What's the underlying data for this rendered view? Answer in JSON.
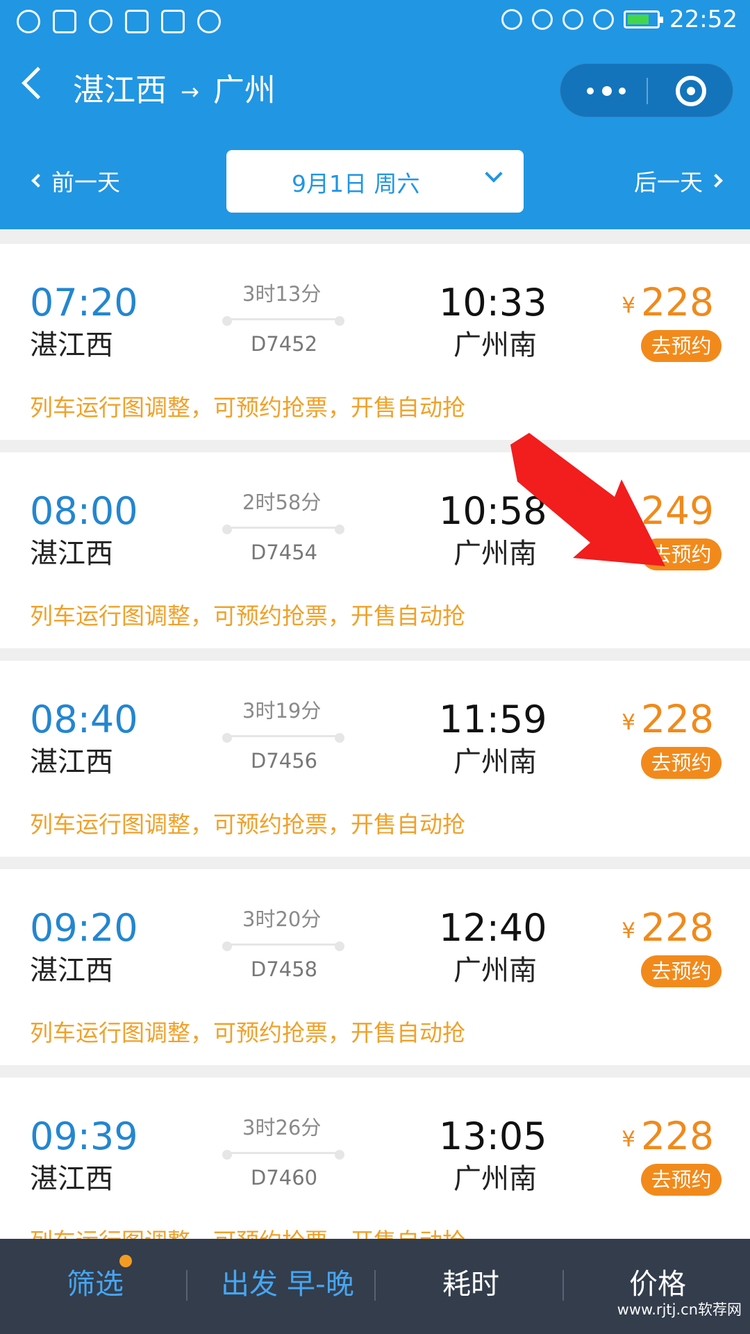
{
  "status_bar": {
    "time": "22:52"
  },
  "header": {
    "origin": "湛江西",
    "arrow": "→",
    "destination": "广州",
    "prev_day": "前一天",
    "date": "9月1日 周六",
    "next_day": "后一天"
  },
  "trains": [
    {
      "dep_time": "07:20",
      "dep_station": "湛江西",
      "duration": "3时13分",
      "train_no": "D7452",
      "arr_time": "10:33",
      "arr_station": "广州南",
      "price_symbol": "¥",
      "price": "228",
      "button": "去预约",
      "notice": "列车运行图调整，可预约抢票，开售自动抢"
    },
    {
      "dep_time": "08:00",
      "dep_station": "湛江西",
      "duration": "2时58分",
      "train_no": "D7454",
      "arr_time": "10:58",
      "arr_station": "广州南",
      "price_symbol": "¥",
      "price": "249",
      "button": "去预约",
      "notice": "列车运行图调整，可预约抢票，开售自动抢"
    },
    {
      "dep_time": "08:40",
      "dep_station": "湛江西",
      "duration": "3时19分",
      "train_no": "D7456",
      "arr_time": "11:59",
      "arr_station": "广州南",
      "price_symbol": "¥",
      "price": "228",
      "button": "去预约",
      "notice": "列车运行图调整，可预约抢票，开售自动抢"
    },
    {
      "dep_time": "09:20",
      "dep_station": "湛江西",
      "duration": "3时20分",
      "train_no": "D7458",
      "arr_time": "12:40",
      "arr_station": "广州南",
      "price_symbol": "¥",
      "price": "228",
      "button": "去预约",
      "notice": "列车运行图调整，可预约抢票，开售自动抢"
    },
    {
      "dep_time": "09:39",
      "dep_station": "湛江西",
      "duration": "3时26分",
      "train_no": "D7460",
      "arr_time": "13:05",
      "arr_station": "广州南",
      "price_symbol": "¥",
      "price": "228",
      "button": "去预约",
      "notice": "列车运行图调整，可预约抢票，开售自动抢"
    }
  ],
  "bottom_bar": {
    "filter": "筛选",
    "departure": "出发 早-晚",
    "duration": "耗时",
    "price": "价格"
  },
  "watermark": "www.rjtj.cn软荐网",
  "colors": {
    "header_blue": "#2196e3",
    "accent_orange": "#f28a1b",
    "notice_orange": "#f0a12a",
    "bottom_bar": "#333d4c"
  }
}
